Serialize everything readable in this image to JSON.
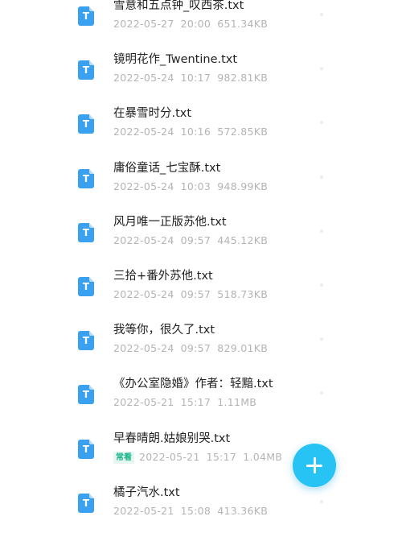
{
  "files": [
    {
      "name": "雪意和五点钟_叹西茶.txt",
      "date": "2022-05-27",
      "time": "20:00",
      "size": "651.34KB",
      "tag": ""
    },
    {
      "name": "镜明花作_Twentine.txt",
      "date": "2022-05-24",
      "time": "10:17",
      "size": "982.81KB",
      "tag": ""
    },
    {
      "name": "在暴雪时分.txt",
      "date": "2022-05-24",
      "time": "10:16",
      "size": "572.85KB",
      "tag": ""
    },
    {
      "name": "庸俗童话_七宝酥.txt",
      "date": "2022-05-24",
      "time": "10:03",
      "size": "948.99KB",
      "tag": ""
    },
    {
      "name": "风月唯一正版苏他.txt",
      "date": "2022-05-24",
      "time": "09:57",
      "size": "445.12KB",
      "tag": ""
    },
    {
      "name": "三拾+番外苏他.txt",
      "date": "2022-05-24",
      "time": "09:57",
      "size": "518.73KB",
      "tag": ""
    },
    {
      "name": "我等你，很久了.txt",
      "date": "2022-05-24",
      "time": "09:57",
      "size": "829.01KB",
      "tag": ""
    },
    {
      "name": "《办公室隐婚》作者：轻黯.txt",
      "date": "2022-05-21",
      "time": "15:17",
      "size": "1.11MB",
      "tag": ""
    },
    {
      "name": "早春晴朗.姑娘别哭.txt",
      "date": "2022-05-21",
      "time": "15:17",
      "size": "1.04MB",
      "tag": "常看"
    },
    {
      "name": "橘子汽水.txt",
      "date": "2022-05-21",
      "time": "15:08",
      "size": "413.36KB",
      "tag": ""
    }
  ],
  "file_icon_letter": "T",
  "icons": {
    "file": "txt-file-icon",
    "more": "more-options-icon",
    "fab": "plus-icon"
  },
  "colors": {
    "accent": "#27c3f4",
    "file_icon": "#3aa0f0",
    "tag_text": "#19b58a",
    "tag_bg": "#e6f7f1"
  }
}
